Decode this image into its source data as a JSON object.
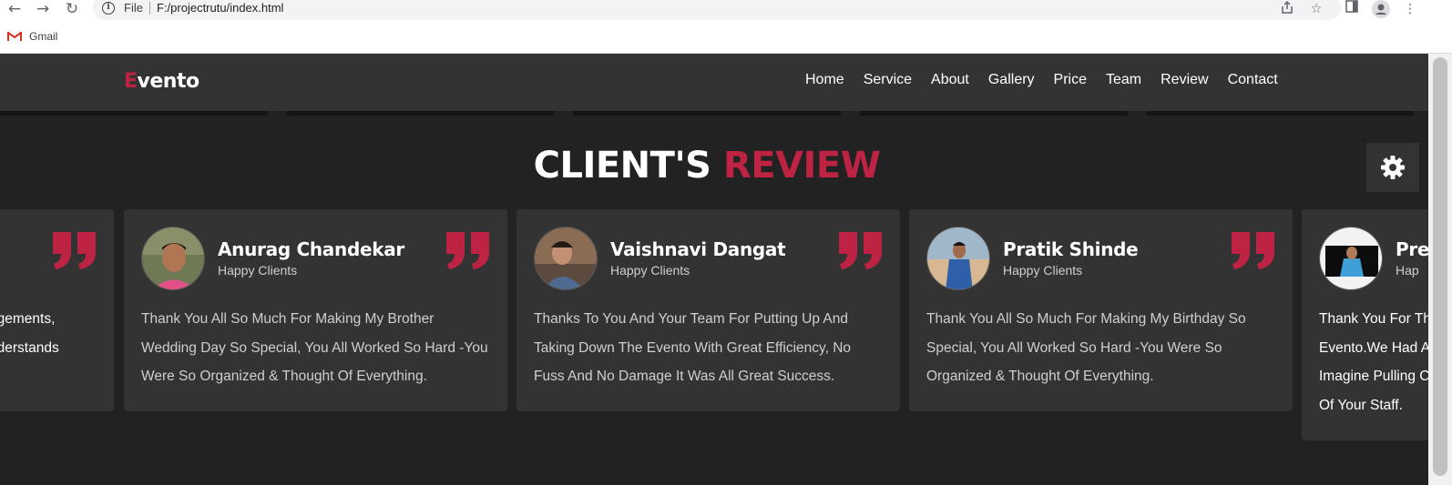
{
  "browser": {
    "file_label": "File",
    "url": "F:/projectrutu/index.html",
    "bookmark": "Gmail"
  },
  "navbar": {
    "logo_first": "E",
    "logo_rest": "vento",
    "links": [
      "Home",
      "Service",
      "About",
      "Gallery",
      "Price",
      "Team",
      "Review",
      "Contact"
    ]
  },
  "section": {
    "title_main": "CLIENT'S",
    "title_accent": "REVIEW"
  },
  "colors": {
    "accent": "#be2344",
    "card": "#333333",
    "background": "#222222"
  },
  "reviews": [
    {
      "name": "",
      "role": "",
      "lines": [
        "ngements,",
        "nderstands"
      ]
    },
    {
      "name": "Anurag Chandekar",
      "role": "Happy Clients",
      "text": "Thank You All So Much For Making My Brother Wedding Day So Special, You All Worked So Hard -You Were So Organized & Thought Of Everything."
    },
    {
      "name": "Vaishnavi Dangat",
      "role": "Happy Clients",
      "text": "Thanks To You And Your Team For Putting Up And Taking Down The Evento With Great Efficiency, No Fuss And No Damage It Was All Great Success."
    },
    {
      "name": "Pratik Shinde",
      "role": "Happy Clients",
      "text": "Thank You All So Much For Making My Birthday So Special, You All Worked So Hard -You Were So Organized & Thought Of Everything."
    },
    {
      "name": "Pre",
      "role": "Hap",
      "lines": [
        "Thank You For Th",
        "Evento.We Had A",
        "Imagine Pulling C",
        "Of Your Staff."
      ]
    }
  ]
}
